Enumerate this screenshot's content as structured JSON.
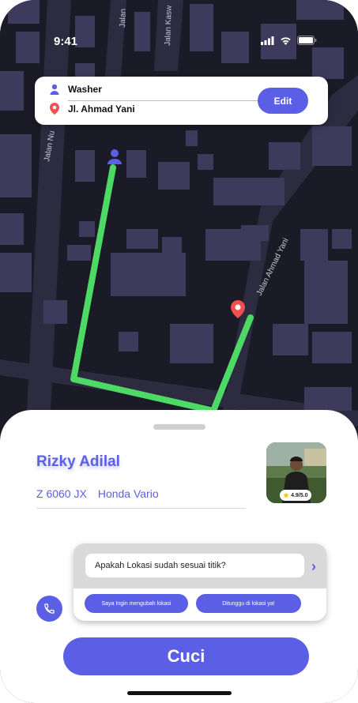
{
  "status_bar": {
    "time": "9:41"
  },
  "map": {
    "street_labels": [
      "Jalan Nu",
      "Jalan",
      "Jalan Kasw",
      "Jalan Ahmad Yani"
    ],
    "route_color": "#4cd964",
    "background_color": "#1b1a27",
    "block_color": "#3d3a5c"
  },
  "location_card": {
    "origin_icon": "person-icon",
    "origin": "Washer",
    "destination_icon": "location-pin-icon",
    "destination": "Jl. Ahmad Yani",
    "edit_label": "Edit"
  },
  "driver": {
    "name": "Rizky Adilal",
    "plate": "Z 6060 JX",
    "vehicle": "Honda Vario",
    "rating": "4.9/5.0"
  },
  "chat": {
    "message": "Apakah Lokasi sudah sesuai titik?",
    "send_icon": "chevron-right-icon",
    "quick_replies": [
      "Saya Ingin mengubah lokasi",
      "Ditunggu di lokasi ya!"
    ]
  },
  "call_icon": "phone-icon",
  "cta_label": "Cuci",
  "colors": {
    "accent": "#5b5fe6",
    "route": "#4cd964",
    "pin": "#f0504f"
  }
}
